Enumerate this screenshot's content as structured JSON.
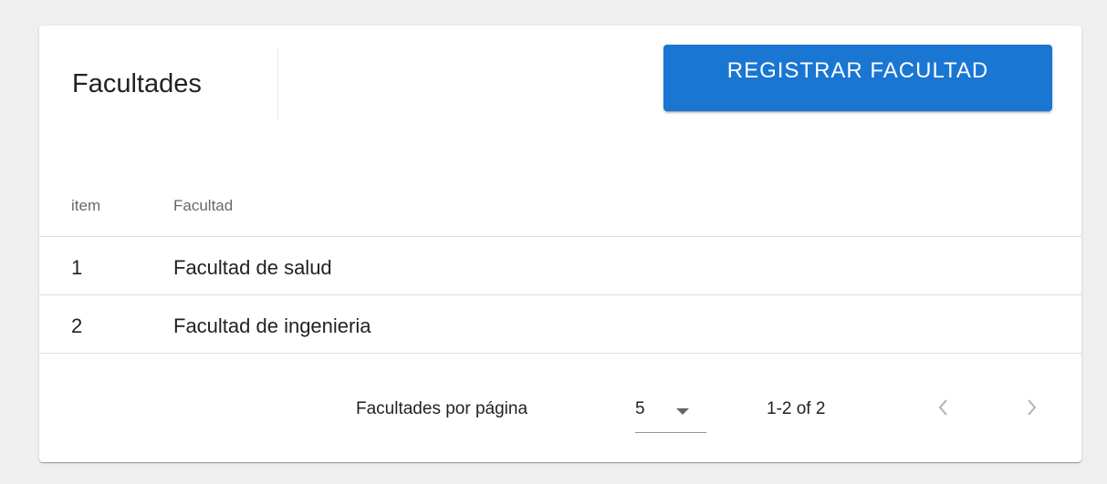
{
  "header": {
    "title": "Facultades",
    "register_button_label": "REGISTRAR FACULTAD",
    "accent_color": "#1976d2"
  },
  "table": {
    "columns": [
      "item",
      "Facultad"
    ],
    "rows": [
      {
        "item": "1",
        "facultad": "Facultad de salud"
      },
      {
        "item": "2",
        "facultad": "Facultad de ingenieria"
      }
    ]
  },
  "pagination": {
    "rows_per_page_label": "Facultades por página",
    "rows_per_page_value": "5",
    "range_text": "1-2 of 2",
    "prev_icon": "chevron-left-icon",
    "next_icon": "chevron-right-icon"
  }
}
